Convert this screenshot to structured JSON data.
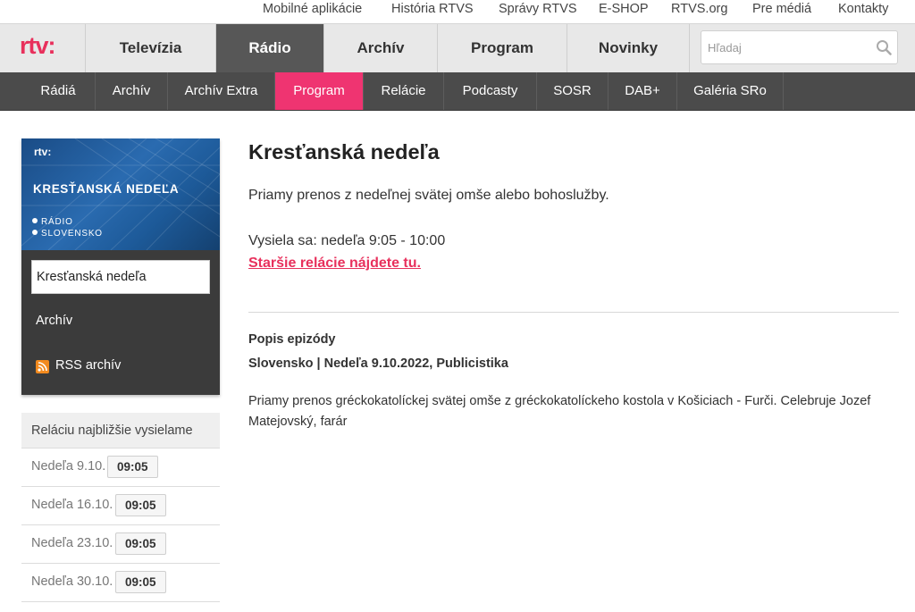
{
  "topbar": {
    "links": [
      "Mobilné aplikácie",
      "História RTVS",
      "Správy RTVS",
      "E-SHOP",
      "RTVS.org",
      "Pre médiá",
      "Kontakty"
    ]
  },
  "mainnav": {
    "logo": "rtv:",
    "tabs": [
      "Televízia",
      "Rádio",
      "Archív",
      "Program",
      "Novinky"
    ],
    "active_tab": "Rádio",
    "search_placeholder": "Hľadaj"
  },
  "subnav": {
    "tabs": [
      "Rádiá",
      "Archív",
      "Archív Extra",
      "Program",
      "Relácie",
      "Podcasty",
      "SOSR",
      "DAB+",
      "Galéria SRo"
    ],
    "active_tab": "Program"
  },
  "sidebar": {
    "banner": {
      "logo": "rtv:",
      "title": "KRESŤANSKÁ NEDEĽA",
      "station_line1": "RÁDIO",
      "station_line2": "SLOVENSKO"
    },
    "menu_active": "Kresťanská nedeľa",
    "menu_archive": "Archív",
    "menu_rss": "RSS archív",
    "upcoming": {
      "heading": "Reláciu najbližšie vysielame",
      "items": [
        {
          "date": "Nedeľa 9.10.",
          "time": "09:05"
        },
        {
          "date": "Nedeľa 16.10.",
          "time": "09:05"
        },
        {
          "date": "Nedeľa 23.10.",
          "time": "09:05"
        },
        {
          "date": "Nedeľa 30.10.",
          "time": "09:05"
        }
      ]
    }
  },
  "main": {
    "title": "Kresťanská nedeľa",
    "lead": "Priamy prenos z nedeľnej svätej omše alebo bohoslužby.",
    "airs": "Vysiela sa: nedeľa 9:05 - 10:00",
    "older_link": "Staršie relácie nájdete tu.",
    "episode": {
      "heading": "Popis epizódy",
      "meta": "Slovensko | Nedeľa 9.10.2022, Publicistika",
      "description": "Priamy prenos gréckokatolíckej svätej omše z gréckokatolíckeho kostola v Košiciach - Furči. Celebruje Jozef Matejovský, farár"
    }
  },
  "colors": {
    "brand_pink": "#e8305c",
    "active_subtab": "#ef3471",
    "active_tab": "#575757",
    "subnav_bg": "#4b4b4b"
  }
}
